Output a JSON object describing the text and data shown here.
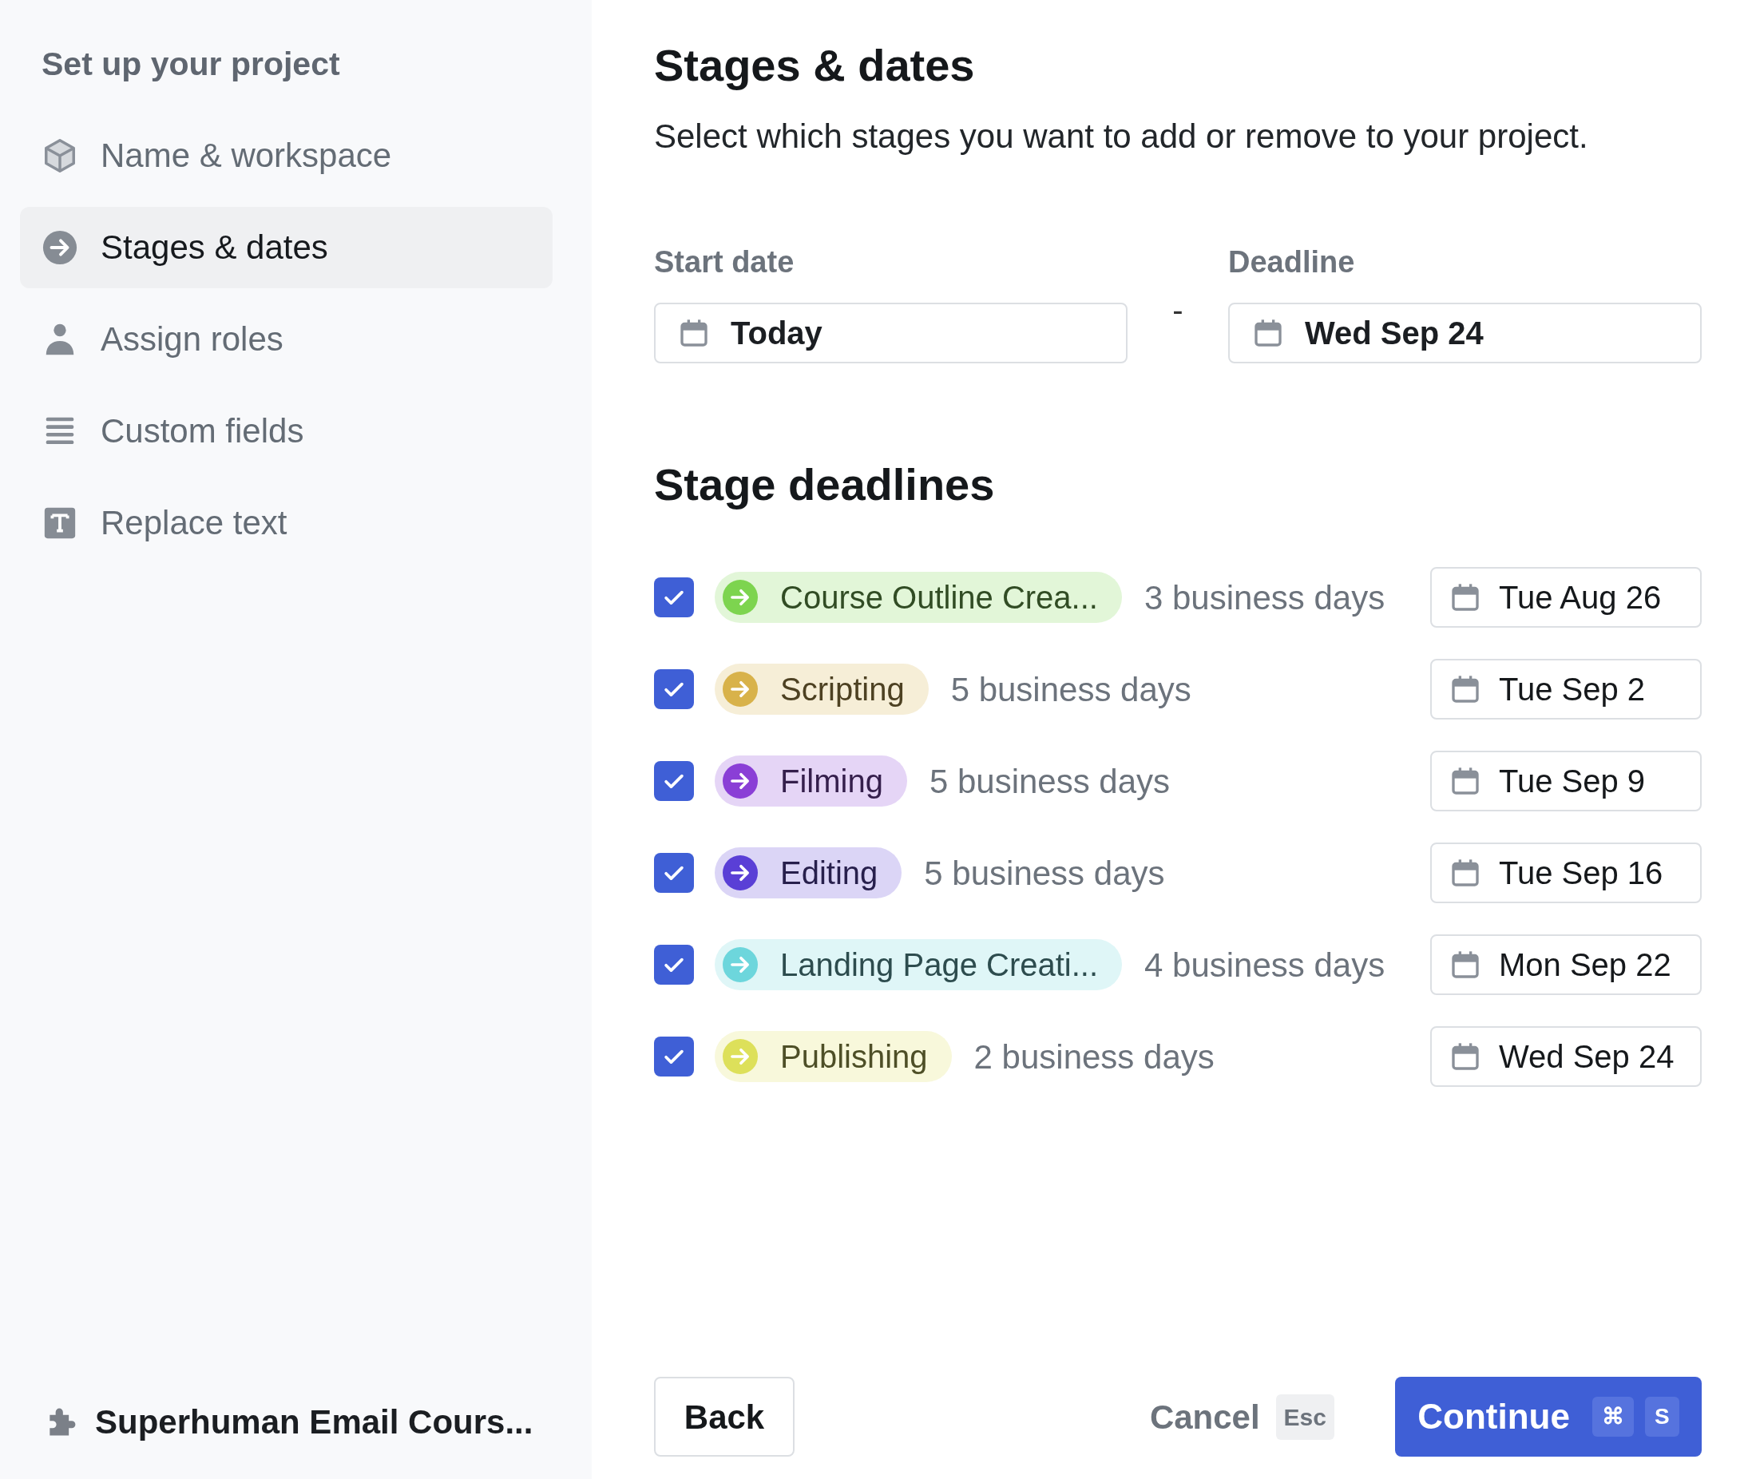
{
  "sidebar": {
    "heading": "Set up your project",
    "items": [
      {
        "label": "Name & workspace",
        "selected": false
      },
      {
        "label": "Stages & dates",
        "selected": true
      },
      {
        "label": "Assign roles",
        "selected": false
      },
      {
        "label": "Custom fields",
        "selected": false
      },
      {
        "label": "Replace text",
        "selected": false
      }
    ],
    "project": "Superhuman Email Cours..."
  },
  "main": {
    "title": "Stages & dates",
    "subtitle": "Select which stages you want to add or remove to your project.",
    "start_date": {
      "label": "Start date",
      "value": "Today"
    },
    "separator": "-",
    "deadline": {
      "label": "Deadline",
      "value": "Wed Sep 24"
    },
    "stages_title": "Stage deadlines",
    "stages": [
      {
        "name": "Course Outline Crea...",
        "color": "#7dd44f",
        "checked": true,
        "duration": "3 business days",
        "date": "Tue Aug 26"
      },
      {
        "name": "Scripting",
        "color": "#d8b24a",
        "checked": true,
        "duration": "5 business days",
        "date": "Tue Sep 2"
      },
      {
        "name": "Filming",
        "color": "#8a3fd6",
        "checked": true,
        "duration": "5 business days",
        "date": "Tue Sep 9"
      },
      {
        "name": "Editing",
        "color": "#5a3fd6",
        "checked": true,
        "duration": "5 business days",
        "date": "Tue Sep 16"
      },
      {
        "name": "Landing Page Creati...",
        "color": "#6dd6dc",
        "checked": true,
        "duration": "4 business days",
        "date": "Mon Sep 22"
      },
      {
        "name": "Publishing",
        "color": "#dde05a",
        "checked": true,
        "duration": "2 business days",
        "date": "Wed Sep 24"
      }
    ]
  },
  "footer": {
    "back": "Back",
    "cancel": "Cancel",
    "cancel_key": "Esc",
    "continue": "Continue",
    "continue_keys": [
      "⌘",
      "S"
    ]
  }
}
